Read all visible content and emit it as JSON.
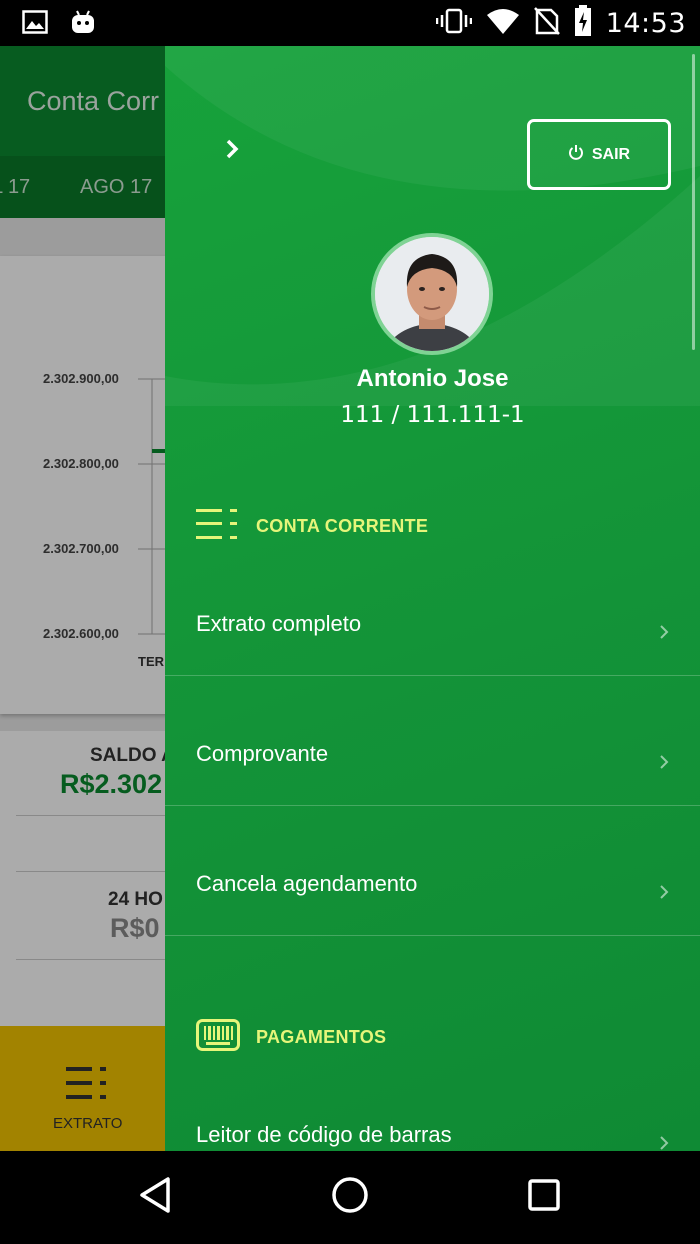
{
  "status_bar": {
    "time": "14:53",
    "icons": [
      "image-icon",
      "android-icon",
      "vibrate-icon",
      "wifi-icon",
      "no-sim-icon",
      "battery-charging-icon"
    ]
  },
  "background_app": {
    "title": "Conta Corr",
    "month_tabs": [
      "L 17",
      "AGO 17"
    ],
    "chart": {
      "y_ticks": [
        "2.302.900,00",
        "2.302.800,00",
        "2.302.700,00",
        "2.302.600,00"
      ],
      "x_tick": "TER"
    },
    "balance": {
      "label": "SALDO A",
      "value": "R$2.302",
      "label_24h": "24 HO",
      "value_24h": "R$0"
    },
    "bottom_nav": {
      "extrato_label": "EXTRATO"
    },
    "colors": {
      "toolbar": "#0b8a30",
      "bottom_nav": "#f2c300",
      "positive_value": "#0a8a2f"
    }
  },
  "drawer": {
    "logout_label": "SAIR",
    "user": {
      "name": "Antonio Jose",
      "account": "111 / 111.111-1"
    },
    "sections": [
      {
        "title": "CONTA CORRENTE",
        "icon": "list-icon",
        "items": [
          "Extrato completo",
          "Comprovante",
          "Cancela agendamento"
        ]
      },
      {
        "title": "PAGAMENTOS",
        "icon": "barcode-icon",
        "items": [
          "Leitor de código de barras"
        ]
      }
    ],
    "colors": {
      "background": "#139338",
      "section_title": "#e6f57a"
    }
  },
  "nav_bar": {
    "buttons": [
      "back-icon",
      "home-icon",
      "recents-icon"
    ]
  }
}
